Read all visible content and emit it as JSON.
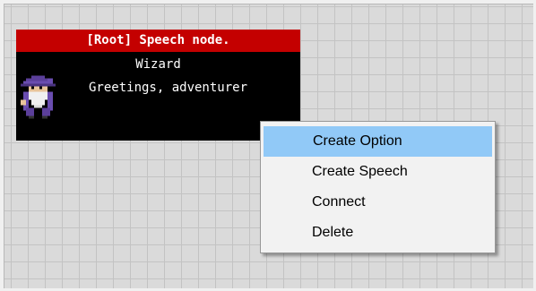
{
  "node": {
    "header": "[Root] Speech node.",
    "speaker": "Wizard",
    "text": "Greetings, adventurer",
    "portrait_icon": "wizard-portrait-icon",
    "header_color": "#c40000",
    "body_color": "#000000"
  },
  "context_menu": {
    "items": [
      {
        "label": "Create Option",
        "highlighted": true
      },
      {
        "label": "Create Speech",
        "highlighted": false
      },
      {
        "label": "Connect",
        "highlighted": false
      },
      {
        "label": "Delete",
        "highlighted": false
      }
    ],
    "highlight_color": "#91c9f7"
  }
}
